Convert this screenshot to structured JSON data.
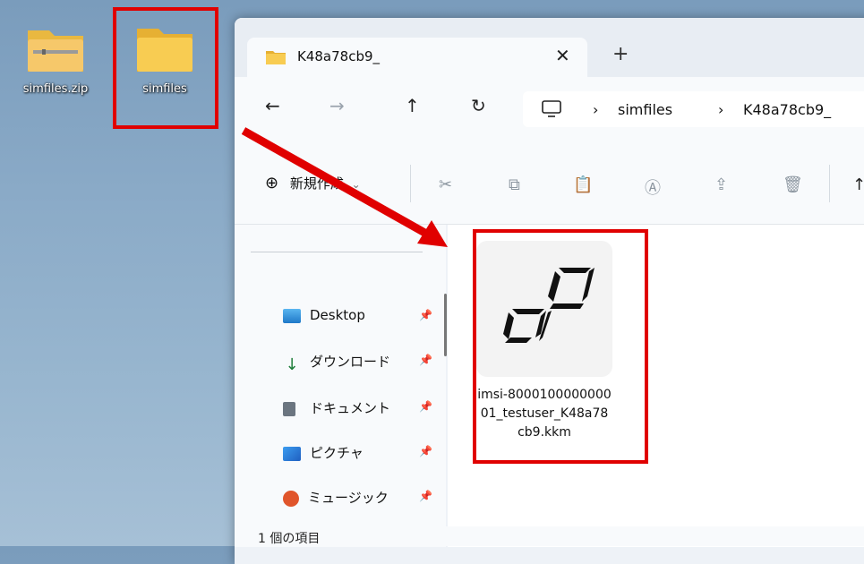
{
  "desktop": {
    "icons": [
      {
        "label": "simfiles.zip"
      },
      {
        "label": "simfiles"
      }
    ]
  },
  "tab": {
    "title": "K48a78cb9_",
    "close": "✕",
    "new": "+"
  },
  "nav": {
    "back": "←",
    "forward": "→",
    "up": "↑",
    "refresh": "↻",
    "sep": "›",
    "crumbs": [
      "simfiles",
      "K48a78cb9_"
    ]
  },
  "toolbar": {
    "new_label": "新規作成",
    "new_icon": "⊕",
    "chevron": "⌄",
    "glyphs": {
      "cut": "✂",
      "copy": "⧉",
      "paste": "📋",
      "rename": "Ⓐ",
      "share": "⇪",
      "delete": "🗑",
      "sort": "↑"
    }
  },
  "sidebar": {
    "items": [
      {
        "label": "Desktop",
        "color": "#2f8fd8"
      },
      {
        "label": "ダウンロード",
        "color": "#1e7d3a"
      },
      {
        "label": "ドキュメント",
        "color": "#6b7580"
      },
      {
        "label": "ピクチャ",
        "color": "#1f6fd0"
      },
      {
        "label": "ミュージック",
        "color": "#e0552b"
      }
    ],
    "pin": "📌"
  },
  "file": {
    "name": "imsi-800010000000001_testuser_K48a78cb9.kkm"
  },
  "status": {
    "count": "1 個の項目"
  },
  "colors": {
    "highlight": "#e00000",
    "folder": "#f6c445"
  }
}
